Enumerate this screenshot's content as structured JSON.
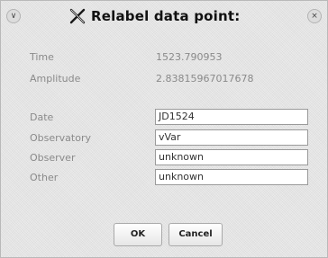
{
  "window": {
    "title": "Relabel data point:",
    "menu_button_glyph": "∨",
    "close_button_glyph": "×",
    "title_icon": "x-window-icon"
  },
  "info": [
    {
      "label": "Time",
      "value": "1523.790953"
    },
    {
      "label": "Amplitude",
      "value": "2.83815967017678"
    }
  ],
  "fields": [
    {
      "label": "Date",
      "value": "JD1524"
    },
    {
      "label": "Observatory",
      "value": "vVar"
    },
    {
      "label": "Observer",
      "value": "unknown"
    },
    {
      "label": "Other",
      "value": "unknown"
    }
  ],
  "buttons": {
    "ok_label": "OK",
    "cancel_label": "Cancel"
  }
}
